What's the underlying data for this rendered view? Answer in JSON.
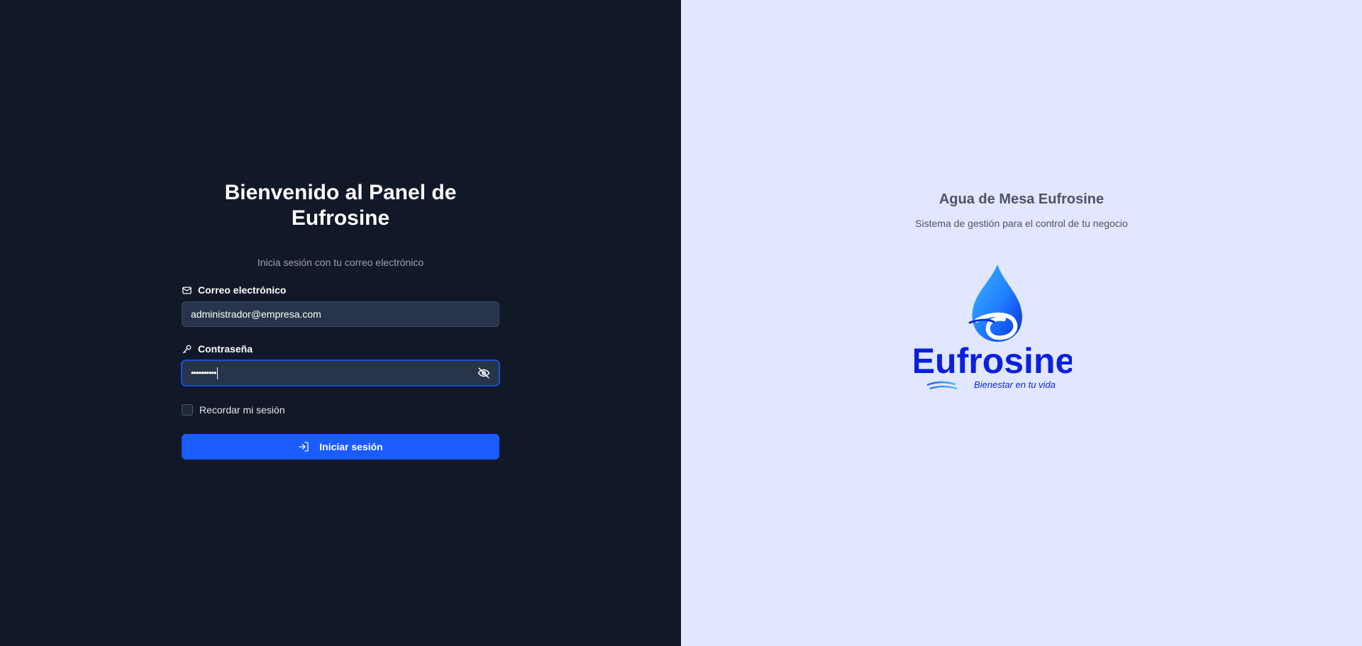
{
  "login": {
    "title": "Bienvenido al Panel de Eufrosine",
    "subtitle": "Inicia sesión con tu correo electrónico",
    "email_label": "Correo electrónico",
    "email_value": "administrador@empresa.com",
    "password_label": "Contraseña",
    "password_masked": "••••••••••",
    "remember_label": "Recordar mi sesión",
    "submit_label": "Iniciar sesión"
  },
  "brand": {
    "title": "Agua de Mesa Eufrosine",
    "subtitle": "Sistema de gestión para el control de tu negocio",
    "logo_name": "Eufrosine",
    "logo_tagline": "Bienestar en tu vida"
  },
  "colors": {
    "left_bg": "#111827",
    "right_bg": "#e0e7ff",
    "primary": "#1a5cff",
    "logo_blue": "#0a1fe0"
  },
  "icons": [
    "mail-icon",
    "key-icon",
    "eye-off-icon",
    "login-arrow-icon",
    "water-drop-logo"
  ]
}
